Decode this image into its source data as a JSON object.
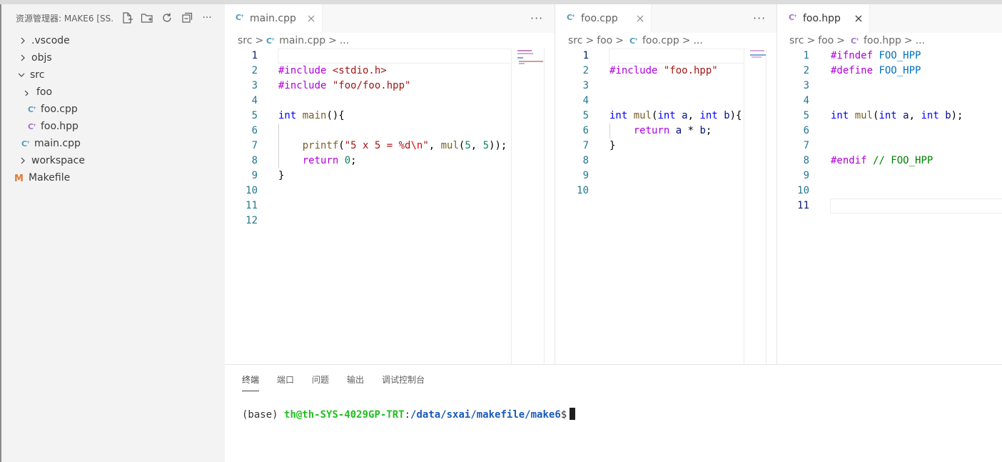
{
  "explorer": {
    "title": "资源管理器: MAKE6 [SS...",
    "tree": [
      {
        "label": ".vscode",
        "kind": "folder",
        "open": false,
        "depth": 0
      },
      {
        "label": "objs",
        "kind": "folder",
        "open": false,
        "depth": 0
      },
      {
        "label": "src",
        "kind": "folder",
        "open": true,
        "depth": 0
      },
      {
        "label": "foo",
        "kind": "folder",
        "open": true,
        "depth": 1
      },
      {
        "label": "foo.cpp",
        "kind": "cpp",
        "depth": 2
      },
      {
        "label": "foo.hpp",
        "kind": "hpp",
        "depth": 2
      },
      {
        "label": "main.cpp",
        "kind": "cpp",
        "depth": 1
      },
      {
        "label": "workspace",
        "kind": "folder",
        "open": false,
        "depth": 0
      },
      {
        "label": "Makefile",
        "kind": "makefile",
        "depth": 0
      }
    ]
  },
  "editors": [
    {
      "tab": "main.cpp",
      "active_tab": false,
      "more": "···",
      "breadcrumb": [
        "src",
        ">",
        "main.cpp",
        ">",
        "..."
      ],
      "line_numbers": [
        "1",
        "2",
        "3",
        "4",
        "5",
        "6",
        "7",
        "8",
        "9",
        "10",
        "11",
        "12"
      ]
    },
    {
      "tab": "foo.cpp",
      "active_tab": false,
      "more": "···",
      "breadcrumb": [
        "src",
        ">",
        "foo",
        ">",
        "foo.cpp",
        ">",
        "..."
      ],
      "line_numbers": [
        "1",
        "2",
        "3",
        "4",
        "5",
        "6",
        "7",
        "8",
        "9",
        "10"
      ]
    },
    {
      "tab": "foo.hpp",
      "active_tab": true,
      "breadcrumb": [
        "src",
        ">",
        "foo",
        ">",
        "foo.hpp",
        ">",
        "..."
      ],
      "line_numbers": [
        "1",
        "2",
        "3",
        "4",
        "5",
        "6",
        "7",
        "8",
        "9",
        "10",
        "11"
      ]
    }
  ],
  "code": {
    "main_cpp": {
      "l2a": "#include ",
      "l2b": "<stdio.h>",
      "l3a": "#include ",
      "l3b": "\"foo/foo.hpp\"",
      "l5a": "int ",
      "l5b": "main",
      "l5c": "(){",
      "l7a": "    printf",
      "l7b": "(",
      "l7c": "\"5 x 5 = %d",
      "l7d": "\\n",
      "l7e": "\"",
      "l7f": ", ",
      "l7g": "mul",
      "l7h": "(",
      "l7i": "5",
      "l7j": ", ",
      "l7k": "5",
      "l7l": "));",
      "l8a": "    return ",
      "l8b": "0",
      "l8c": ";",
      "l9": "}"
    },
    "foo_cpp": {
      "l2a": "#include ",
      "l2b": "\"foo.hpp\"",
      "l5a": "int ",
      "l5b": "mul",
      "l5c": "(",
      "l5d": "int ",
      "l5e": "a",
      "l5f": ", ",
      "l5g": "int ",
      "l5h": "b",
      "l5i": "){",
      "l6a": "    return ",
      "l6b": "a",
      "l6c": " * ",
      "l6d": "b",
      "l6e": ";",
      "l7": "}"
    },
    "foo_hpp": {
      "l1a": "#ifndef ",
      "l1b": "FOO_HPP",
      "l2a": "#define ",
      "l2b": "FOO_HPP",
      "l5a": "int ",
      "l5b": "mul",
      "l5c": "(",
      "l5d": "int ",
      "l5e": "a",
      "l5f": ", ",
      "l5g": "int ",
      "l5h": "b",
      "l5i": ");",
      "l8a": "#endif ",
      "l8b": "// FOO_HPP"
    }
  },
  "panel": {
    "tabs": [
      "终端",
      "端口",
      "问题",
      "输出",
      "调试控制台"
    ],
    "active": "终端",
    "terminal": {
      "prefix": "(base) ",
      "user_host": "th@th-SYS-4029GP-TRT",
      "colon": ":",
      "path": "/data/sxai/makefile/make6",
      "prompt": "$"
    }
  },
  "colors": {
    "keyword": "#0000ff",
    "preprocessor": "#af00db",
    "string": "#a31515",
    "number": "#098658",
    "function": "#795e26",
    "comment": "#008000",
    "macro": "#0070c1",
    "cpp_icon": "#519aba",
    "hpp_icon": "#a074c4",
    "makefile_icon": "#e37933"
  }
}
